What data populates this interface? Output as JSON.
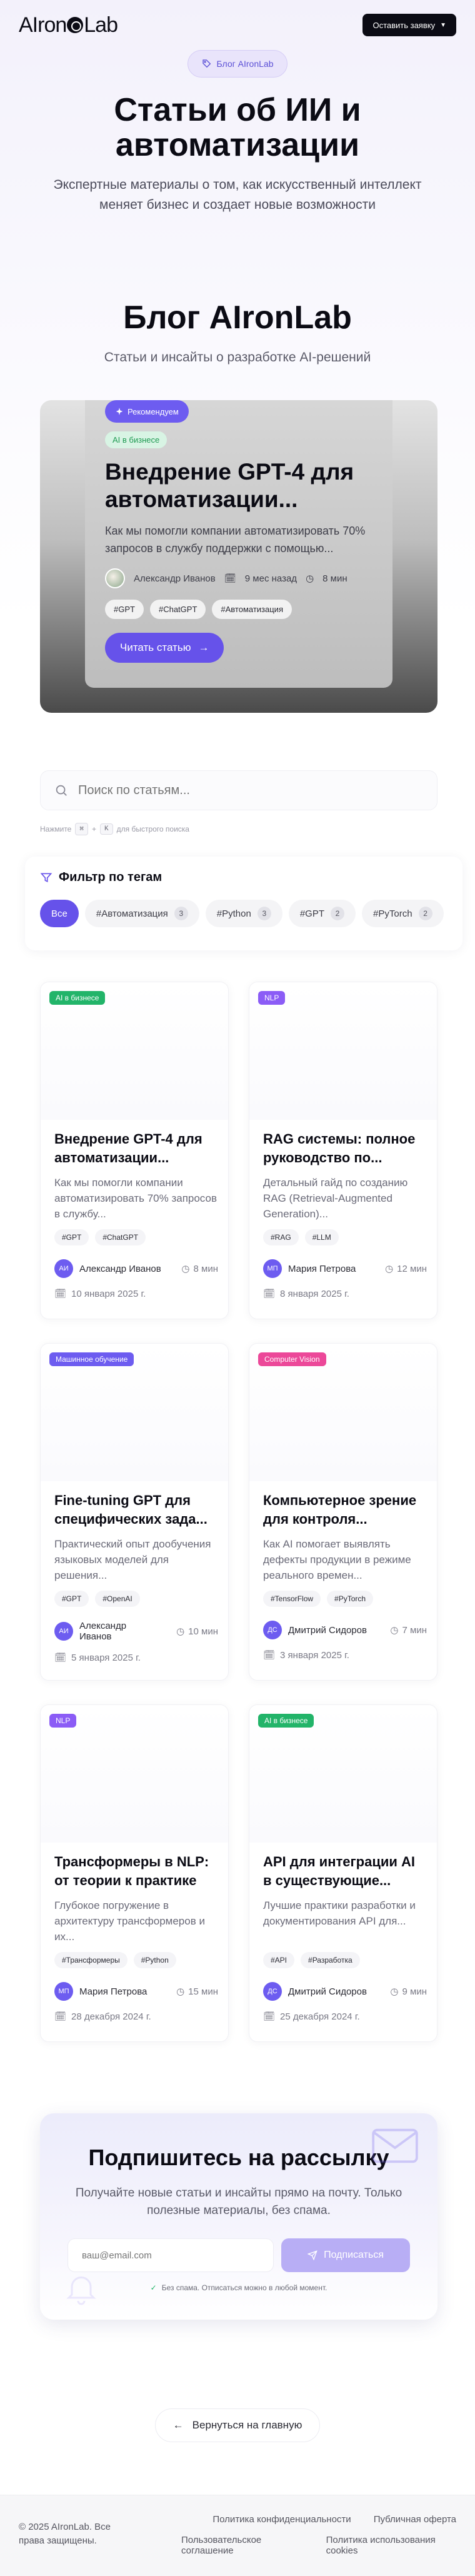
{
  "header": {
    "logo_text_left": "AIron",
    "logo_text_right": "Lab",
    "cta_label": "Оставить заявку"
  },
  "hero": {
    "badge": "Блог AIronLab",
    "title": "Статьи об ИИ и автоматизации",
    "subtitle": "Экспертные материалы о том, как искусственный интеллект меняет бизнес и создает новые возможности"
  },
  "blog": {
    "title": "Блог AIronLab",
    "subtitle": "Статьи и инсайты о разработке AI-решений"
  },
  "featured": {
    "badge": "Рекомендуем",
    "category": "AI в бизнесе",
    "title": "Внедрение GPT-4 для автоматизации...",
    "description": "Как мы помогли компании автоматизировать 70% запросов в службу поддержки с помощью...",
    "author": "Александр Иванов",
    "date": "9 мес назад",
    "read_time": "8 мин",
    "tags": [
      "#GPT",
      "#ChatGPT",
      "#Автоматизация"
    ],
    "button": "Читать статью"
  },
  "search": {
    "placeholder": "Поиск по статьям...",
    "hint_prefix": "Нажмите",
    "key1": "⌘",
    "key2": "K",
    "hint_suffix": "для быстрого поиска"
  },
  "filter": {
    "title": "Фильтр по тегам",
    "chips": [
      {
        "label": "Все",
        "count": ""
      },
      {
        "label": "#Автоматизация",
        "count": "3"
      },
      {
        "label": "#Python",
        "count": "3"
      },
      {
        "label": "#GPT",
        "count": "2"
      },
      {
        "label": "#PyTorch",
        "count": "2"
      }
    ]
  },
  "articles": [
    {
      "category": "AI в бизнесе",
      "cat_color": "#22b469",
      "title": "Внедрение GPT-4 для автоматизации...",
      "description": "Как мы помогли компании автоматизировать 70% запросов в службу...",
      "tags": [
        "#GPT",
        "#ChatGPT"
      ],
      "author": "Александр Иванов",
      "initials": "АИ",
      "read_time": "8 мин",
      "date": "10 января 2025 г."
    },
    {
      "category": "NLP",
      "cat_color": "#8b5cf6",
      "title": "RAG системы: полное руководство по...",
      "description": "Детальный гайд по созданию RAG (Retrieval-Augmented Generation)...",
      "tags": [
        "#RAG",
        "#LLM"
      ],
      "author": "Мария Петрова",
      "initials": "МП",
      "read_time": "12 мин",
      "date": "8 января 2025 г."
    },
    {
      "category": "Машинное обучение",
      "cat_color": "#6d5cf0",
      "title": "Fine-tuning GPT для специфических зада...",
      "description": "Практический опыт дообучения языковых моделей для решения...",
      "tags": [
        "#GPT",
        "#OpenAI"
      ],
      "author": "Александр Иванов",
      "initials": "АИ",
      "read_time": "10 мин",
      "date": "5 января 2025 г."
    },
    {
      "category": "Computer Vision",
      "cat_color": "#ec4899",
      "title": "Компьютерное зрение для контроля...",
      "description": "Как AI помогает выявлять дефекты продукции в режиме реального времен...",
      "tags": [
        "#TensorFlow",
        "#PyTorch"
      ],
      "author": "Дмитрий Сидоров",
      "initials": "ДС",
      "read_time": "7 мин",
      "date": "3 января 2025 г."
    },
    {
      "category": "NLP",
      "cat_color": "#8b5cf6",
      "title": "Трансформеры в NLP: от теории к практике",
      "description": "Глубокое погружение в архитектуру трансформеров и их...",
      "tags": [
        "#Трансформеры",
        "#Python"
      ],
      "author": "Мария Петрова",
      "initials": "МП",
      "read_time": "15 мин",
      "date": "28 декабря 2024 г."
    },
    {
      "category": "AI в бизнесе",
      "cat_color": "#22b469",
      "title": "API для интеграции AI в существующие...",
      "description": "Лучшие практики разработки и документирования API для...",
      "tags": [
        "#API",
        "#Разработка"
      ],
      "author": "Дмитрий Сидоров",
      "initials": "ДС",
      "read_time": "9 мин",
      "date": "25 декабря 2024 г."
    }
  ],
  "newsletter": {
    "title": "Подпишитесь на рассылку",
    "text": "Получайте новые статьи и инсайты прямо на почту. Только полезные материалы, без спама.",
    "placeholder": "ваш@email.com",
    "button": "Подписаться",
    "note": "Без спама. Отписаться можно в любой момент."
  },
  "back_button": "Вернуться на главную",
  "footer": {
    "copyright": "© 2025 AIronLab. Все права защищены.",
    "links": [
      "Политика конфиденциальности",
      "Публичная оферта",
      "Пользовательское соглашение",
      "Политика использования cookies"
    ]
  },
  "colors": {
    "accent": "#6652ea",
    "dark": "#0b0b14",
    "green": "#22b469",
    "pink": "#ec4899",
    "violet": "#8b5cf6"
  }
}
